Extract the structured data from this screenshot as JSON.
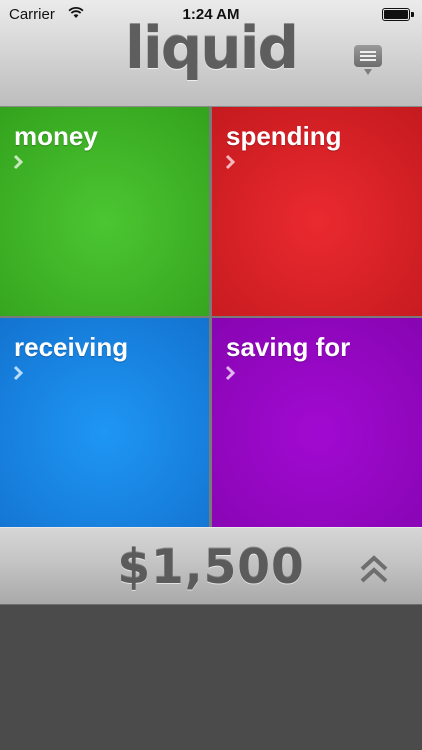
{
  "status_bar": {
    "carrier": "Carrier",
    "time": "1:24 AM",
    "icons": [
      "wifi-icon",
      "battery-icon"
    ]
  },
  "header": {
    "logo_text": "liquid",
    "menu_icon": "menu-list-icon"
  },
  "tiles": [
    {
      "label": "money",
      "color": "#3aae24",
      "icon": "chevron-right-icon"
    },
    {
      "label": "spending",
      "color": "#dc2227",
      "icon": "chevron-right-icon"
    },
    {
      "label": "receiving",
      "color": "#1884e6",
      "icon": "chevron-right-icon"
    },
    {
      "label": "saving for",
      "color": "#9508c4",
      "icon": "chevron-right-icon"
    }
  ],
  "total": {
    "amount": "$1,500",
    "expand_icon": "double-chevron-up-icon"
  },
  "colors": {
    "chrome_gray": "#c8c8c8",
    "embossed_text": "#5e5e5e",
    "background": "#4b4b4b"
  }
}
